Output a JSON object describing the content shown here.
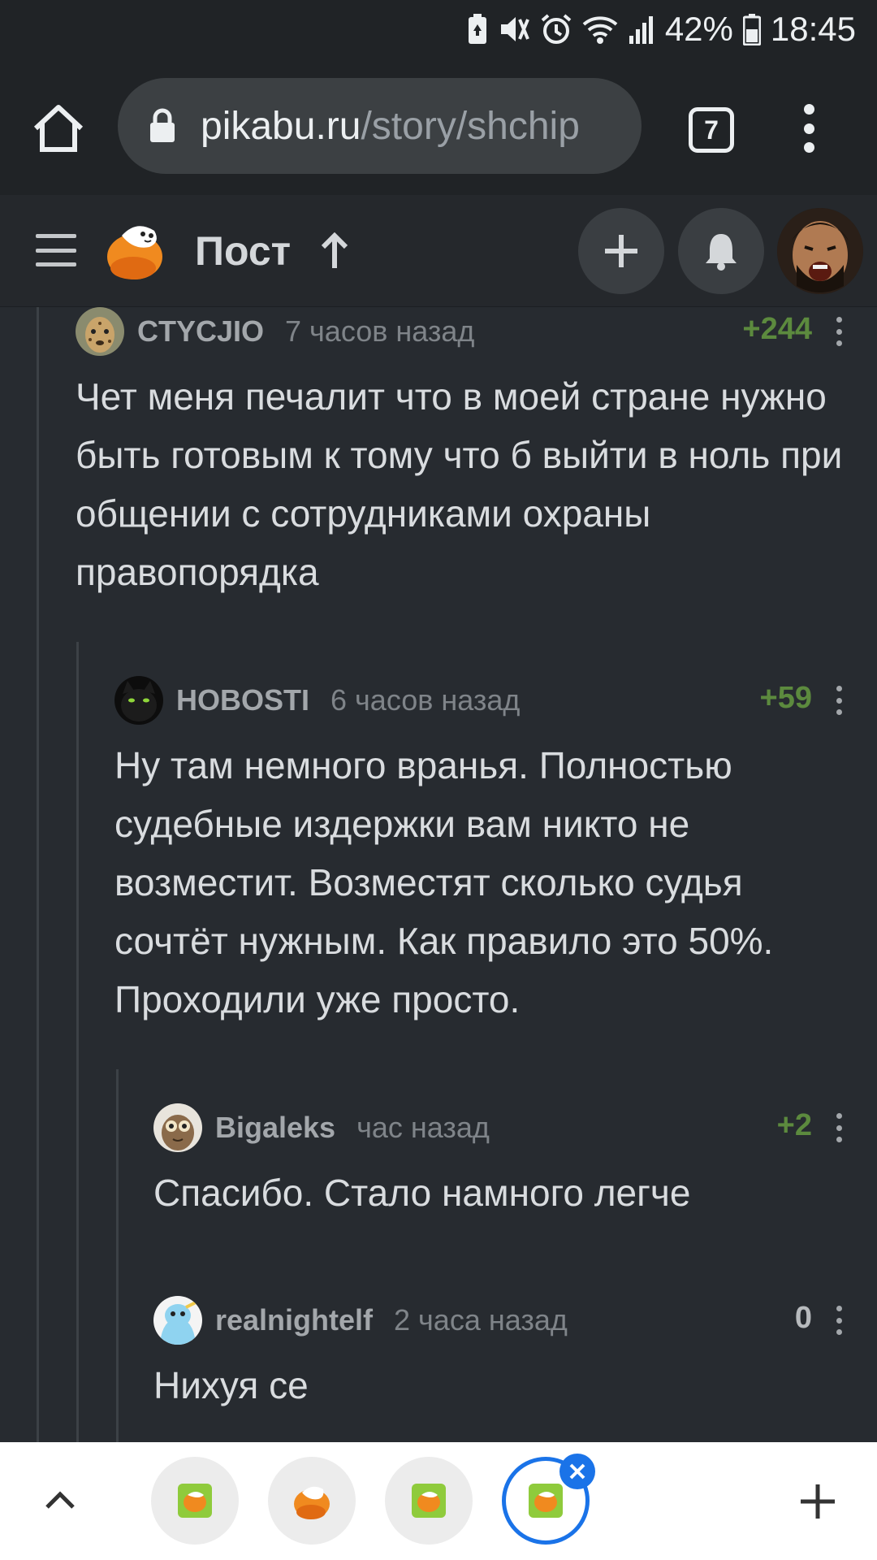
{
  "status_bar": {
    "battery_percent": "42%",
    "time": "18:45"
  },
  "browser": {
    "url_host": "pikabu.ru",
    "url_path": "/story/shchip",
    "tab_count": "7"
  },
  "header": {
    "title": "Пост"
  },
  "comments": [
    {
      "user": "CTYCJIO",
      "time": "7 часов назад",
      "rating": "+244",
      "text": "Чет меня печалит что в моей стране нужно быть готовым к тому что б выйти в ноль при общении с сотрудниками охраны правопорядка"
    },
    {
      "user": "HOBOSTI",
      "time": "6 часов назад",
      "rating": "+59",
      "text": "Ну там немного вранья. Полностью судебные издержки вам никто не возместит. Возместят сколько судья сочтёт нужным. Как правило это 50%. Проходили уже просто."
    },
    {
      "user": "Bigaleks",
      "time": "час назад",
      "rating": "+2",
      "text": "Спасибо. Стало намного легче"
    },
    {
      "user": "realnightelf",
      "time": "2 часа назад",
      "rating": "0",
      "text": "Нихуя се"
    }
  ],
  "colors": {
    "background": "#272b30",
    "positive_rating": "#5c8a3e",
    "accent_blue": "#1a73e8",
    "logo_orange": "#f08a1f"
  }
}
